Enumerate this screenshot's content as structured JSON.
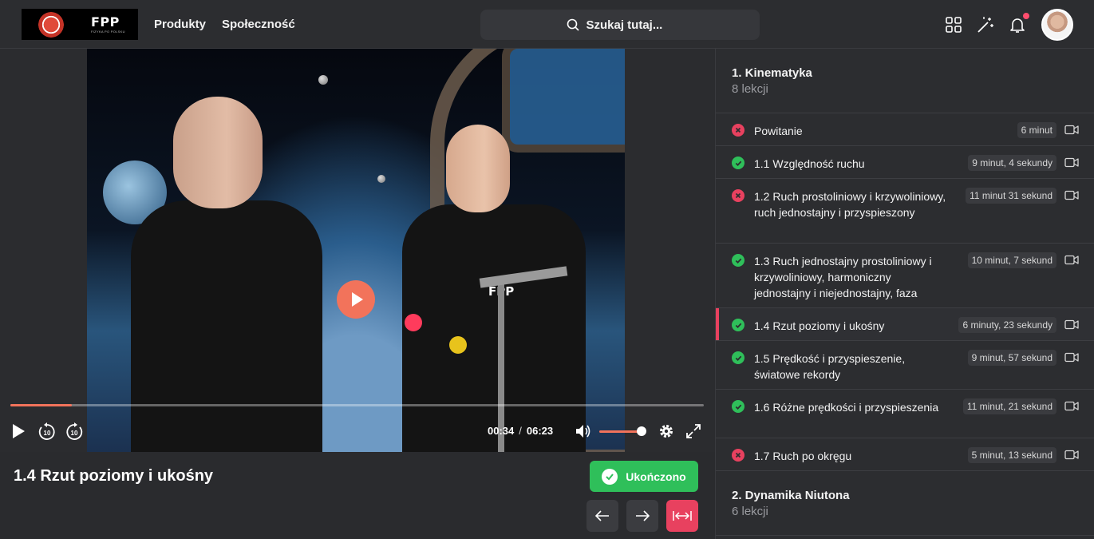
{
  "header": {
    "logo_text": "FPP",
    "logo_subtext": "FIZYKA PO POLSKU",
    "nav": [
      "Produkty",
      "Społeczność"
    ],
    "search_placeholder": "Szukaj tutaj...",
    "icons": [
      "apps-grid-icon",
      "magic-wand-icon",
      "bell-icon"
    ],
    "has_notification": true
  },
  "player": {
    "current_time": "00:34",
    "separator": "/",
    "duration": "06:23",
    "progress": 0.089,
    "volume": 1.0,
    "accent_color": "#f2735b"
  },
  "lesson": {
    "title": "1.4 Rzut poziomy i ukośny",
    "complete_label": "Ukończono",
    "complete_color": "#2fbf5a"
  },
  "sidebar": {
    "chapters": [
      {
        "title": "1. Kinematyka",
        "subtitle": "8 lekcji",
        "lessons": [
          {
            "label": "Powitanie",
            "duration": "6 minut",
            "status": "not-done",
            "active": false
          },
          {
            "label": "1.1 Względność ruchu",
            "duration": "9 minut, 4 sekundy",
            "status": "done",
            "active": false
          },
          {
            "label": "1.2 Ruch prostoliniowy i krzywoliniowy, ruch jednostajny i przyspieszony",
            "duration": "11 minut 31 sekund",
            "status": "not-done",
            "active": false
          },
          {
            "label": "1.3 Ruch jednostajny prostoliniowy i krzywoliniowy, harmoniczny jednostajny i niejednostajny, faza",
            "duration": "10 minut, 7 sekund",
            "status": "done",
            "active": false
          },
          {
            "label": "1.4 Rzut poziomy i ukośny",
            "duration": "6 minuty, 23 sekundy",
            "status": "done",
            "active": true
          },
          {
            "label": "1.5 Prędkość i przyspieszenie, światowe rekordy",
            "duration": "9 minut, 57 sekund",
            "status": "done",
            "active": false
          },
          {
            "label": "1.6 Różne prędkości i przyspieszenia",
            "duration": "11 minut, 21 sekund",
            "status": "done",
            "active": false
          },
          {
            "label": "1.7 Ruch po okręgu",
            "duration": "5 minut, 13 sekund",
            "status": "not-done",
            "active": false
          }
        ]
      },
      {
        "title": "2. Dynamika Niutona",
        "subtitle": "6 lekcji"
      }
    ]
  },
  "colors": {
    "done": "#2fbf5a",
    "not_done": "#e8415f",
    "active_marker": "#e8415f"
  }
}
